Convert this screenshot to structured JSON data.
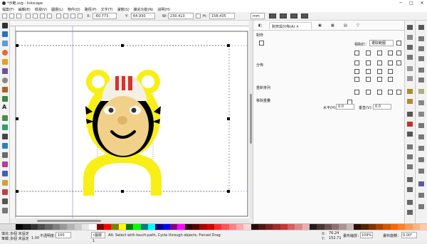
{
  "window": {
    "title": "*示範.svg - Inkscape",
    "min": "─",
    "max": "□",
    "close": "✕"
  },
  "menu": [
    "檔案(F)",
    "編輯(E)",
    "檢視(V)",
    "圖層(L)",
    "物件(O)",
    "路徑(P)",
    "文字(T)",
    "濾鏡(S)",
    "擴充功能(N)",
    "說明(H)"
  ],
  "toolbar": {
    "x_label": "X:",
    "x_value": "-60.773",
    "y_label": "Y:",
    "y_value": "64.930",
    "w_label": "W:",
    "w_value": "230.413",
    "h_label": "H:",
    "h_value": "158.435",
    "unit": "mm"
  },
  "panel": {
    "tab_label": "對齊與分佈(A)",
    "tab_close": "✕",
    "align_title": "對齊",
    "relative_label": "相對於：",
    "relative_value": "選取範圍",
    "distribute_title": "分佈",
    "rearrange_title": "重新排列",
    "remove_overlap_title": "移除重疊",
    "h_gap_label": "水平(H)：",
    "h_gap_value": "0.0",
    "v_gap_label": "垂直(V)：",
    "v_gap_value": "0.0"
  },
  "status": {
    "fill_label": "填充：",
    "fill_value": "多個 未設定",
    "stroke_label": "筆觸：",
    "stroke_value": "多個 未設定",
    "stroke_width": "1.00",
    "opacity_label": "不透明度：",
    "opacity_value": "100",
    "layer_value": "•圖層 1",
    "message": "Alt: Select with touch-path, Cycle through objects, Forced Drag",
    "x_coord_label": "X：",
    "x_coord": "76.24",
    "y_coord_label": "Y：",
    "y_coord": "152.71",
    "zoom_label": "畫布縮放：",
    "zoom_value": "109%",
    "rotate_label": "畫布旋轉：",
    "rotate_value": "0.00°"
  },
  "colors": {
    "accent": "#2f6fbd",
    "yellow": "#f7ef16",
    "black": "#000000"
  }
}
